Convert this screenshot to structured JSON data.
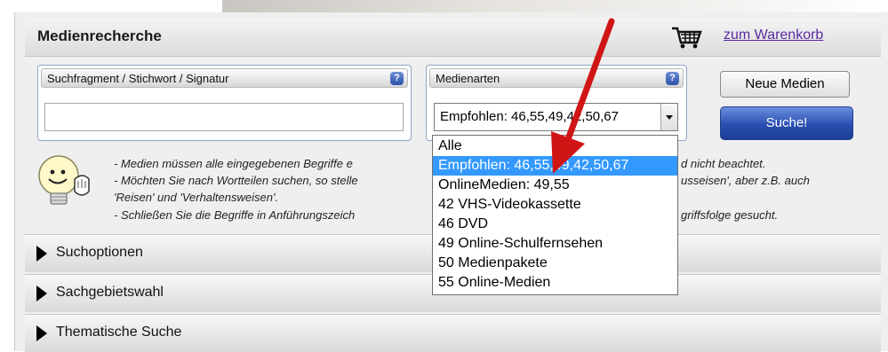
{
  "header": {
    "title": "Medienrecherche",
    "cart_link": "zum Warenkorb"
  },
  "search_panel": {
    "label": "Suchfragment / Stichwort / Signatur",
    "help": "?",
    "input_value": ""
  },
  "media_panel": {
    "label": "Medienarten",
    "help": "?",
    "selected": "Empfohlen: 46,55,49,42,50,67"
  },
  "buttons": {
    "new_media": "Neue Medien",
    "search": "Suche!"
  },
  "hints": [
    "- Medien müssen alle eingegebenen Begriffe e",
    "d nicht beachtet.",
    "- Möchten Sie nach Wortteilen suchen, so stelle",
    "usseisen', aber z.B. auch",
    "'Reisen' und 'Verhaltensweisen'.",
    "- Schließen Sie die Begriffe in Anführungszeich",
    "griffsfolge gesucht."
  ],
  "dropdown_options": [
    "Alle",
    "Empfohlen: 46,55,49,42,50,67",
    "OnlineMedien: 49,55",
    "42 VHS-Videokassette",
    "46 DVD",
    "49 Online-Schulfernsehen",
    "50 Medienpakete",
    "55 Online-Medien"
  ],
  "dropdown_highlighted": "Empfohlen: 46,55,49,42,50,67",
  "accordions": [
    "Suchoptionen",
    "Sachgebietswahl",
    "Thematische Suche"
  ],
  "colors": {
    "accent_blue": "#2a4fb0",
    "highlight": "#3399ff",
    "link": "#5b2aa0",
    "annotation_arrow": "#d01515"
  }
}
